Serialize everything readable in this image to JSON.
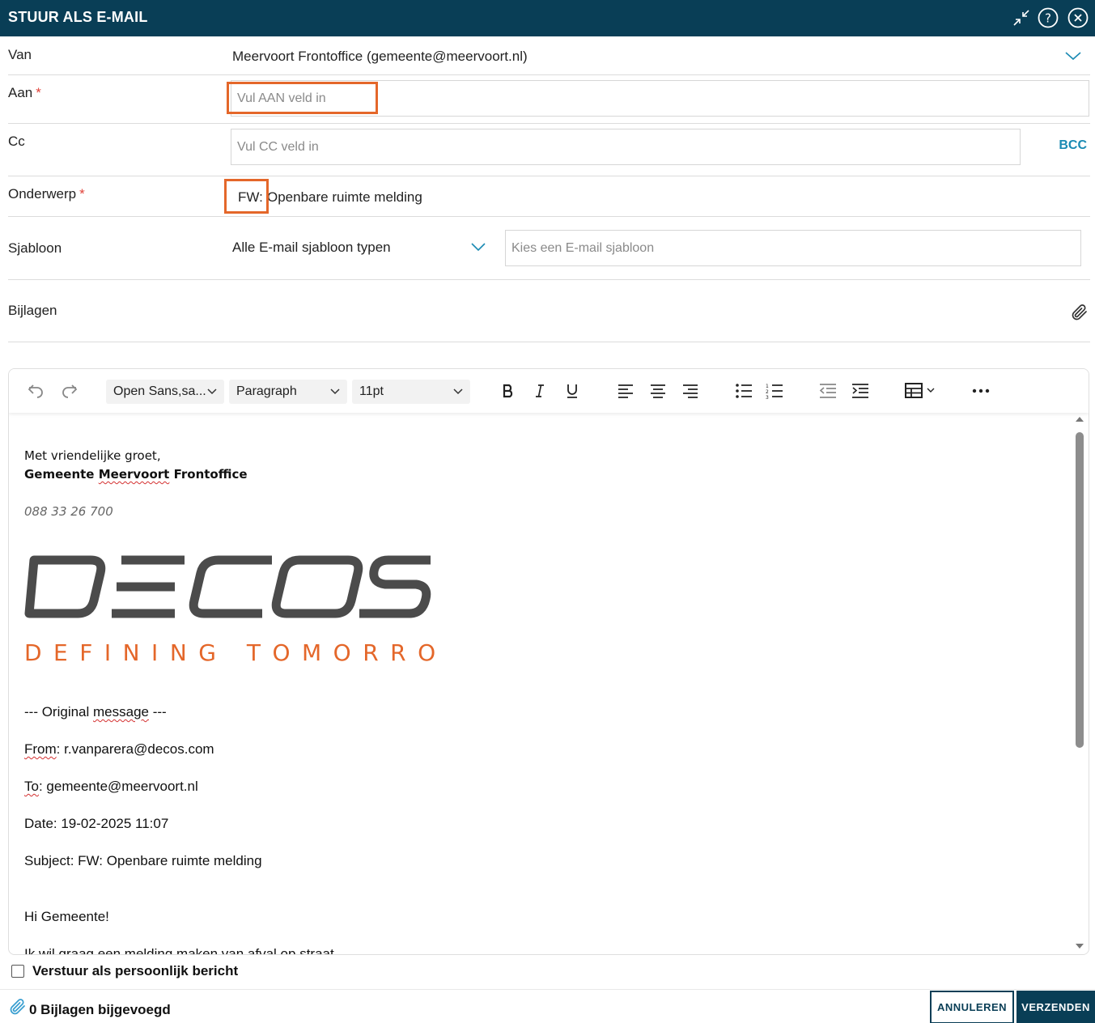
{
  "dialog": {
    "title": "STUUR ALS E-MAIL"
  },
  "from": {
    "label": "Van",
    "value": "Meervoort Frontoffice (gemeente@meervoort.nl)"
  },
  "to": {
    "label": "Aan",
    "required_mark": "*",
    "placeholder": "Vul AAN veld in"
  },
  "cc": {
    "label": "Cc",
    "placeholder": "Vul CC veld in",
    "bcc_label": "BCC"
  },
  "subject": {
    "label": "Onderwerp",
    "required_mark": "*",
    "prefix": "FW:",
    "value": "Openbare ruimte melding"
  },
  "template": {
    "label": "Sjabloon",
    "type_value": "Alle E-mail sjabloon typen",
    "placeholder": "Kies een E-mail sjabloon"
  },
  "attachments": {
    "label": "Bijlagen",
    "icon": "paperclip-icon"
  },
  "toolbar": {
    "font_family": "Open Sans,sa...",
    "block_format": "Paragraph",
    "font_size": "11pt"
  },
  "body": {
    "greeting": "Met vriendelijke groet,",
    "sig_name_a": "Gemeente ",
    "sig_name_b": "Meervoort",
    "sig_name_c": " Frontoffice",
    "phone": "088 33 26 700",
    "logo_text": "DECOS",
    "logo_tagline": "DEFINING TOMORROW",
    "orig_a": "--- Original ",
    "orig_b": "message",
    "orig_c": " ---",
    "from_a": "From",
    "from_b": ": r.vanparera@decos.com",
    "to_a": "To",
    "to_b": ": gemeente@meervoort.nl",
    "date_line": "Date: 19-02-2025 11:07",
    "subject_line": "Subject: FW: Openbare ruimte melding",
    "hi_line": "Hi Gemeente!",
    "body_line": "Ik wil graag een melding maken van afval op straat"
  },
  "personal": {
    "label": "Verstuur als persoonlijk bericht",
    "checked": false
  },
  "footer": {
    "attachments_count": "0 Bijlagen bijgevoegd",
    "cancel_label": "ANNULEREN",
    "send_label": "VERZENDEN"
  },
  "colors": {
    "titlebar": "#093e56",
    "accent": "#1a8ab3",
    "highlight": "#e4672a",
    "required": "#e0433a",
    "logo_gray": "#4b4b4b",
    "logo_orange": "#e4672a"
  }
}
